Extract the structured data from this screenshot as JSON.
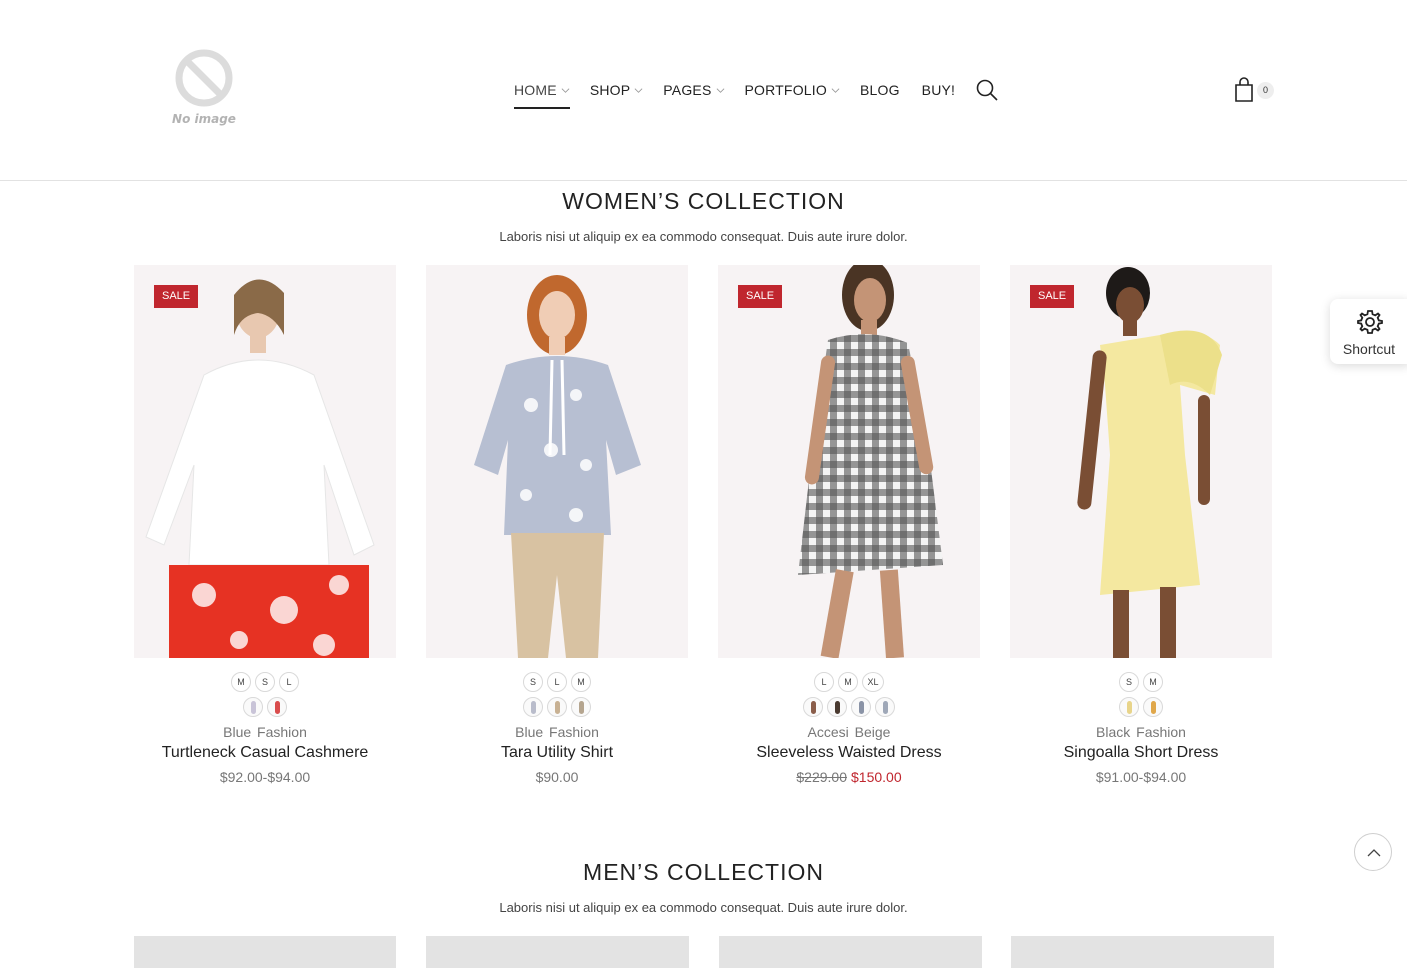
{
  "header": {
    "logo_text": "No image",
    "nav": [
      {
        "label": "HOME",
        "dropdown": true,
        "active": true
      },
      {
        "label": "SHOP",
        "dropdown": true
      },
      {
        "label": "PAGES",
        "dropdown": true
      },
      {
        "label": "PORTFOLIO",
        "dropdown": true
      },
      {
        "label": "BLOG",
        "dropdown": false
      },
      {
        "label": "BUY!",
        "dropdown": false
      }
    ],
    "search_icon": "search-icon",
    "cart_icon": "shopping-bag-icon",
    "cart_count": "0"
  },
  "womens": {
    "title": "WOMEN’S COLLECTION",
    "subtitle": "Laboris nisi ut aliquip ex ea commodo consequat. Duis aute irure dolor.",
    "products": [
      {
        "sale": "SALE",
        "sizes": [
          "M",
          "S",
          "L"
        ],
        "swatch_colors": [
          "#c9c4d8",
          "#d94c4c"
        ],
        "vendor": "Blue Fashion",
        "name": "Turtleneck Casual Cashmere",
        "price": "$92.00-$94.00",
        "top_color": "#ffffff",
        "bottom_color": "#e63223"
      },
      {
        "sale": "",
        "sizes": [
          "S",
          "L",
          "M"
        ],
        "swatch_colors": [
          "#b9bccb",
          "#c8b193",
          "#b5a58f"
        ],
        "vendor": "Blue Fashion",
        "name": "Tara Utility Shirt",
        "price": "$90.00",
        "top_color": "#b7bfd2",
        "bottom_color": "#d8c2a2"
      },
      {
        "sale": "SALE",
        "sizes": [
          "L",
          "M",
          "XL"
        ],
        "swatch_colors": [
          "#8a5d4a",
          "#4a3a30",
          "#8a93a6",
          "#9fa8b8"
        ],
        "vendor": "Accesi Beige",
        "name": "Sleeveless Waisted Dress",
        "price_old": "$229.00",
        "price_new": "$150.00",
        "top_color": "#2f2f2f",
        "bottom_color": "#5a5a5a"
      },
      {
        "sale": "SALE",
        "sizes": [
          "S",
          "M"
        ],
        "swatch_colors": [
          "#e8d48a",
          "#e0a74a"
        ],
        "vendor": "Black Fashion",
        "name": "Singoalla Short Dress",
        "price": "$91.00-$94.00",
        "top_color": "#f4e8a0",
        "bottom_color": "#f4e8a0"
      }
    ]
  },
  "mens": {
    "title": "MEN’S COLLECTION",
    "subtitle": "Laboris nisi ut aliquip ex ea commodo consequat. Duis aute irure dolor."
  },
  "shortcut": {
    "label": "Shortcut",
    "icon": "gear-icon"
  },
  "back_to_top_icon": "chevron-up-icon",
  "colors": {
    "accent_sale": "#c0262e",
    "card_bg": "#f7f3f4"
  }
}
